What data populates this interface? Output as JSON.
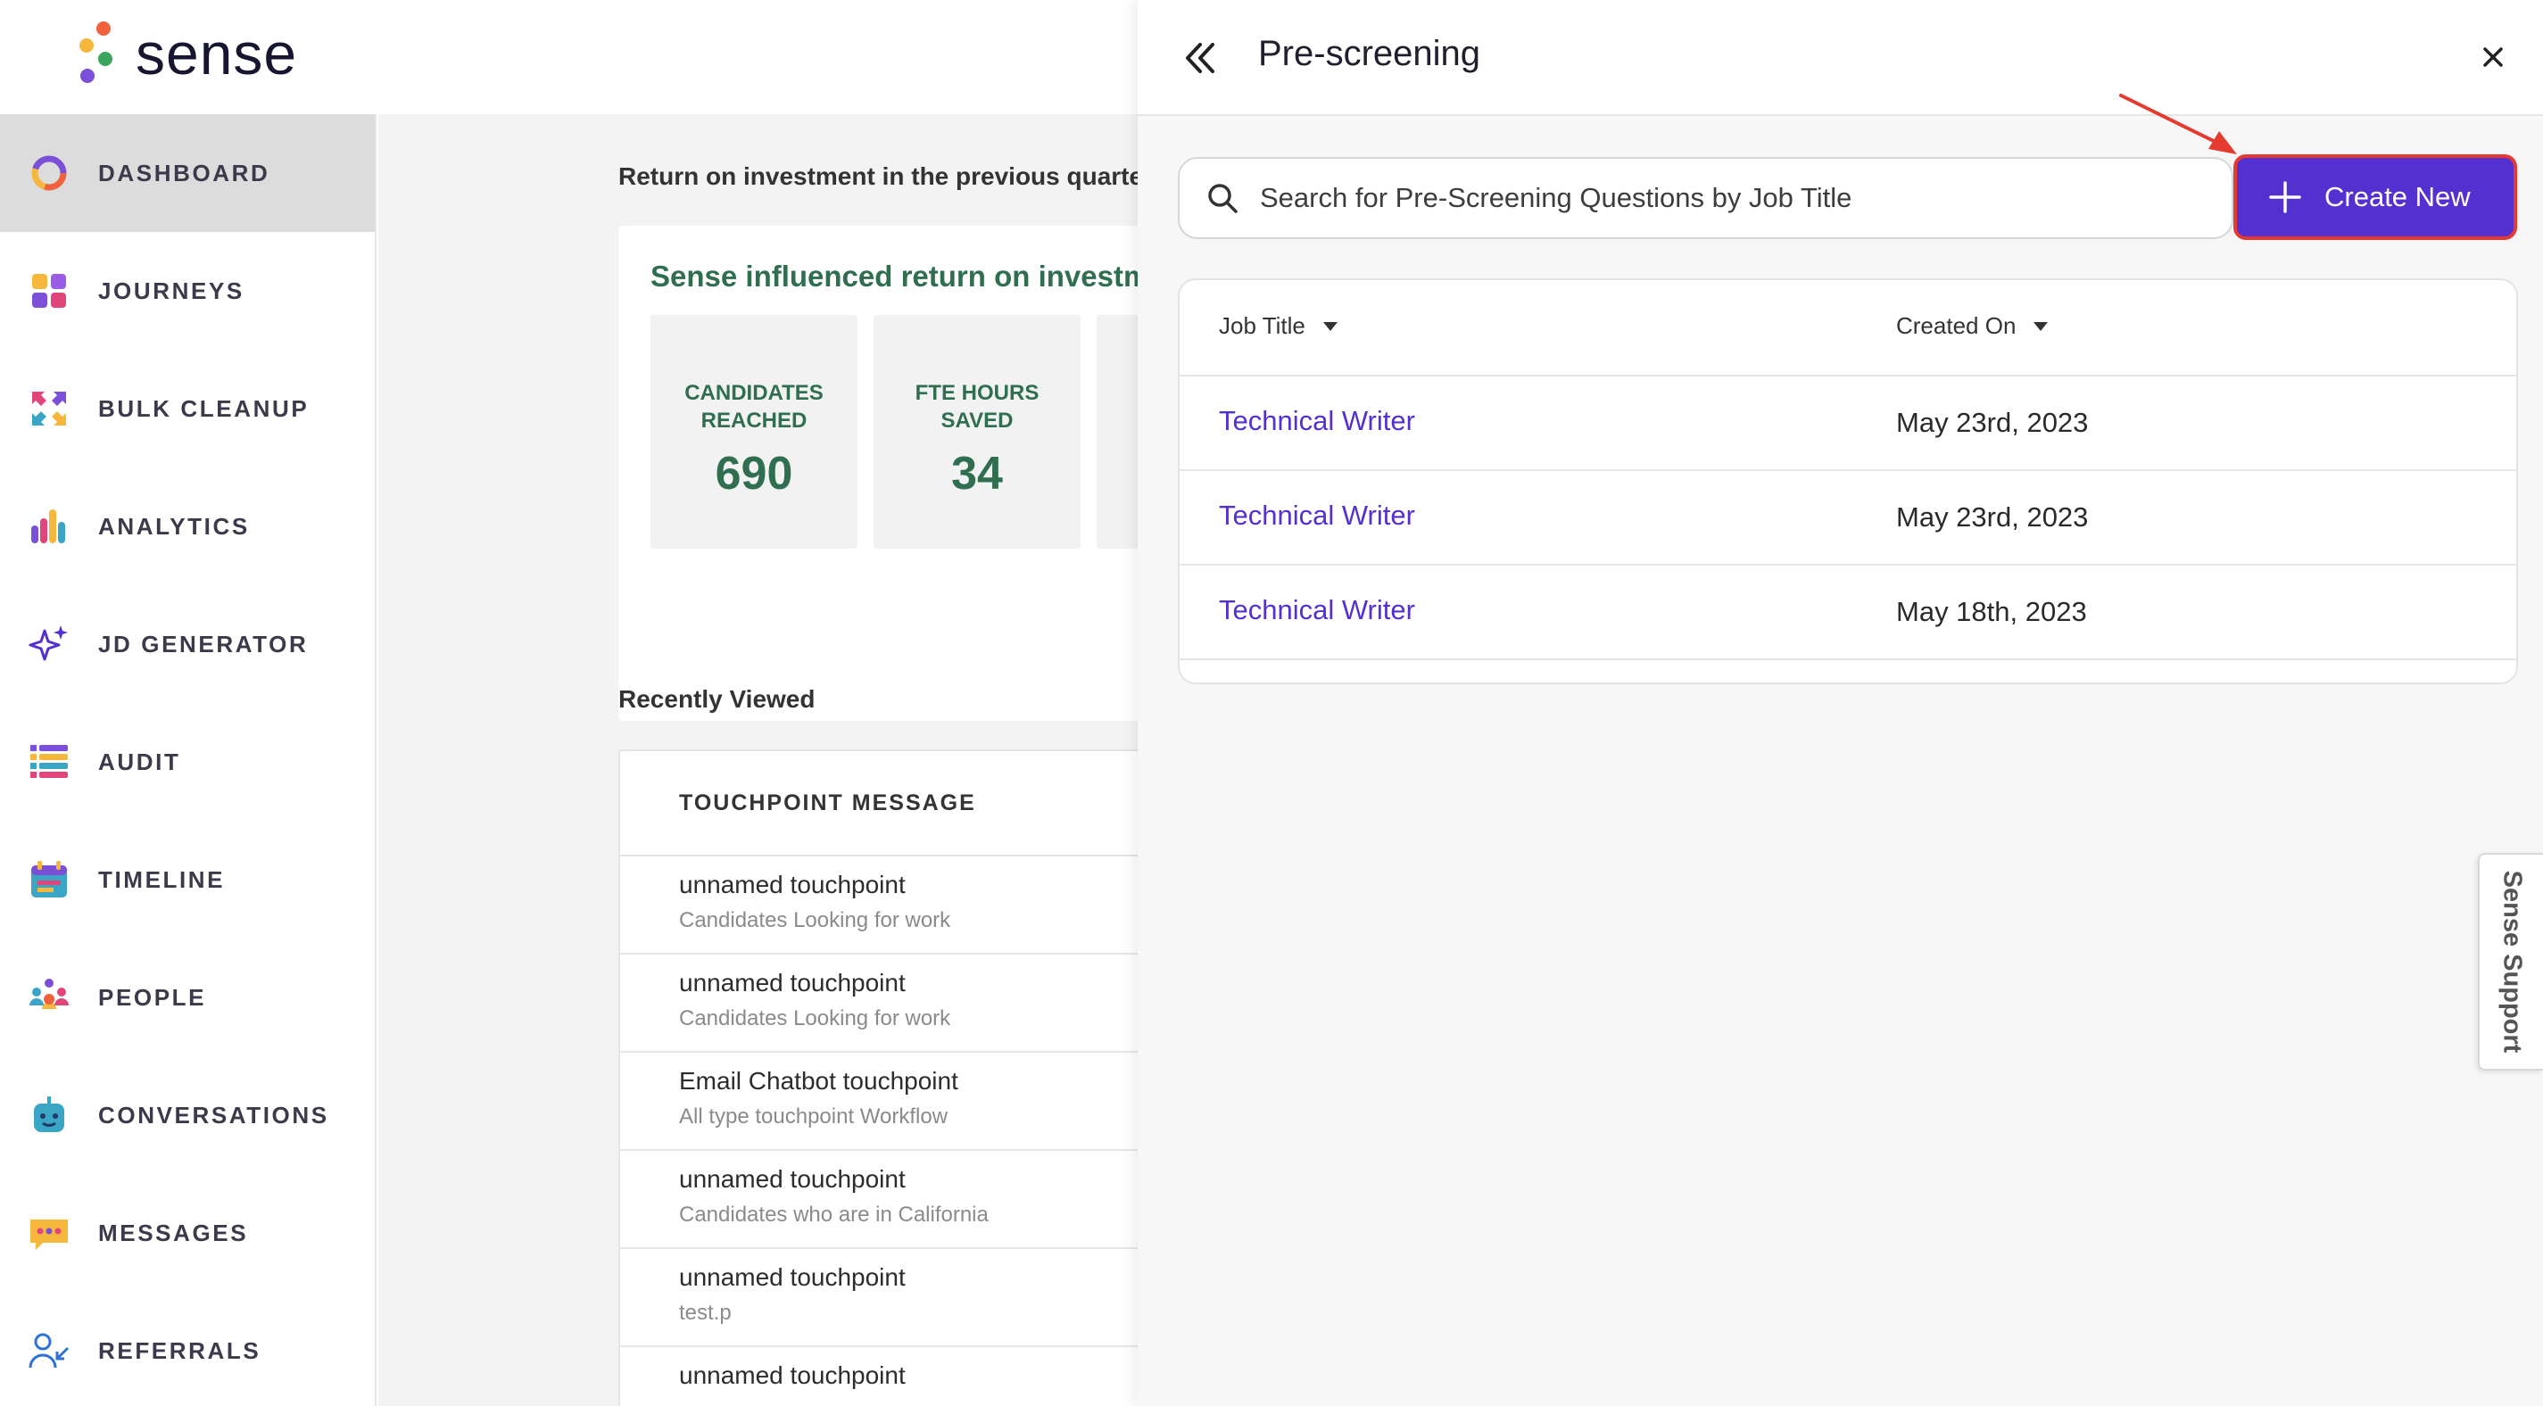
{
  "brand": {
    "name": "sense"
  },
  "sidebar": {
    "items": [
      {
        "label": "DASHBOARD",
        "icon": "dashboard-icon",
        "active": true
      },
      {
        "label": "JOURNEYS",
        "icon": "journeys-icon"
      },
      {
        "label": "BULK CLEANUP",
        "icon": "bulk-cleanup-icon"
      },
      {
        "label": "ANALYTICS",
        "icon": "analytics-icon"
      },
      {
        "label": "JD GENERATOR",
        "icon": "sparkle-icon"
      },
      {
        "label": "AUDIT",
        "icon": "audit-icon"
      },
      {
        "label": "TIMELINE",
        "icon": "calendar-icon"
      },
      {
        "label": "PEOPLE",
        "icon": "people-icon"
      },
      {
        "label": "CONVERSATIONS",
        "icon": "robot-icon"
      },
      {
        "label": "MESSAGES",
        "icon": "message-icon"
      },
      {
        "label": "REFERRALS",
        "icon": "referral-icon"
      }
    ]
  },
  "dashboard": {
    "roi_title": "Return on investment in the previous quarter",
    "roi_card_title": "Sense influenced return on investment",
    "metrics": [
      {
        "label": "CANDIDATES REACHED",
        "value": "690"
      },
      {
        "label": "FTE HOURS SAVED",
        "value": "34"
      }
    ],
    "recently_viewed_title": "Recently Viewed",
    "table_header": "TOUCHPOINT MESSAGE",
    "rows": [
      {
        "name": "unnamed touchpoint",
        "sub": "Candidates Looking for work"
      },
      {
        "name": "unnamed touchpoint",
        "sub": "Candidates Looking for work"
      },
      {
        "name": "Email Chatbot touchpoint",
        "sub": "All type touchpoint Workflow"
      },
      {
        "name": "unnamed touchpoint",
        "sub": "Candidates who are in California"
      },
      {
        "name": "unnamed touchpoint",
        "sub": "test.p"
      },
      {
        "name": "unnamed touchpoint",
        "sub": ""
      }
    ]
  },
  "panel": {
    "title": "Pre-screening",
    "search_placeholder": "Search for Pre-Screening Questions by Job Title",
    "create_label": "Create New",
    "columns": {
      "job_title": "Job Title",
      "created_on": "Created On"
    },
    "rows": [
      {
        "job_title": "Technical Writer",
        "created_on": "May 23rd, 2023"
      },
      {
        "job_title": "Technical Writer",
        "created_on": "May 23rd, 2023"
      },
      {
        "job_title": "Technical Writer",
        "created_on": "May 18th, 2023"
      }
    ]
  },
  "support": {
    "label": "Sense Support"
  },
  "colors": {
    "accent": "#5530d1",
    "highlight": "#e53a2f",
    "metric_green": "#2f6f4f"
  }
}
